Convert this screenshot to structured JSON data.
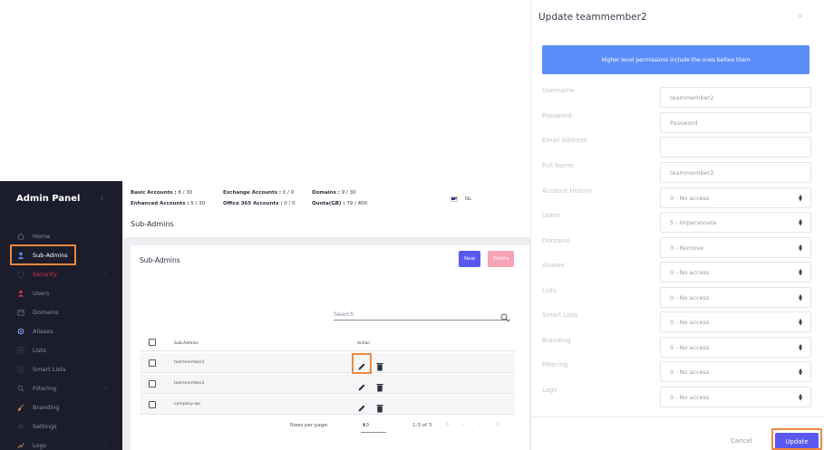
{
  "sidebar": {
    "title": "Admin Panel",
    "collapse_icon": "chevron-left-icon",
    "items": [
      {
        "label": "Home",
        "icon": "home-icon",
        "has_arrow": false
      },
      {
        "label": "Sub-Admins",
        "icon": "user-icon",
        "has_arrow": false,
        "state": "active"
      },
      {
        "label": "Security",
        "icon": "shield-icon",
        "has_arrow": true,
        "state": "red"
      },
      {
        "label": "Users",
        "icon": "users-icon",
        "has_arrow": false
      },
      {
        "label": "Domains",
        "icon": "calendar-icon",
        "has_arrow": true
      },
      {
        "label": "Aliases",
        "icon": "aliases-icon",
        "has_arrow": false
      },
      {
        "label": "Lists",
        "icon": "list-icon",
        "has_arrow": false
      },
      {
        "label": "Smart Lists",
        "icon": "smart-list-icon",
        "has_arrow": false
      },
      {
        "label": "Filtering",
        "icon": "search-icon",
        "has_arrow": true
      },
      {
        "label": "Branding",
        "icon": "brush-icon",
        "has_arrow": false
      },
      {
        "label": "Settings",
        "icon": "gear-icon",
        "has_arrow": false
      },
      {
        "label": "Logs",
        "icon": "chart-icon",
        "has_arrow": true
      }
    ]
  },
  "stats": {
    "basic_label": "Basic Accounts :",
    "basic_value": "8 / 30",
    "enhanced_label": "Enhanced Accounts :",
    "enhanced_value": "5 / 30",
    "exchange_label": "Exchange Accounts :",
    "exchange_value": "0 / 0",
    "office_label": "Office 365 Accounts :",
    "office_value": "0 / 0",
    "domains_label": "Domains :",
    "domains_value": "9 / 30",
    "quota_label": "Quota(GB) :",
    "quota_value": "79 / 400"
  },
  "language": {
    "code": "NL",
    "flag": "netherlands-flag"
  },
  "page": {
    "title": "Sub-Admins"
  },
  "card": {
    "title": "Sub-Admins",
    "new_label": "New",
    "delete_label": "Delete",
    "search_placeholder": "Search"
  },
  "table": {
    "columns": [
      "Sub-Admins",
      "Action"
    ],
    "rows": [
      {
        "name": "teammember1"
      },
      {
        "name": "teammember2"
      },
      {
        "name": "company-api"
      }
    ]
  },
  "pager": {
    "rows_per_page_label": "Rows per page:",
    "rows_per_page_value": "10",
    "range": "1-3 of 3"
  },
  "modal": {
    "title": "Update teammember2",
    "close": "×",
    "banner": "Higher level permissions include the ones before them",
    "fields": [
      {
        "label": "Username",
        "value": "teammember2",
        "type": "text"
      },
      {
        "label": "Password",
        "value": "",
        "placeholder": "Password",
        "type": "text"
      },
      {
        "label": "Email Address",
        "value": "",
        "type": "text"
      },
      {
        "label": "Full Name",
        "value": "teammember2",
        "type": "text"
      },
      {
        "label": "Account History",
        "value": "0 - No access",
        "type": "select"
      },
      {
        "label": "Users",
        "value": "5 - Impersonate",
        "type": "select"
      },
      {
        "label": "Domains",
        "value": "3 - Remove",
        "type": "select"
      },
      {
        "label": "Aliases",
        "value": "0 - No access",
        "type": "select"
      },
      {
        "label": "Lists",
        "value": "0 - No access",
        "type": "select"
      },
      {
        "label": "Smart Lists",
        "value": "0 - No access",
        "type": "select"
      },
      {
        "label": "Branding",
        "value": "0 - No access",
        "type": "select"
      },
      {
        "label": "Filtering",
        "value": "0 - No access",
        "type": "select"
      },
      {
        "label": "Logs",
        "value": "0 - No access",
        "type": "select"
      }
    ],
    "cancel_label": "Cancel",
    "update_label": "Update"
  },
  "colors": {
    "sidebar_bg": "#1c1d2c",
    "accent": "#5b58f0",
    "danger": "#e0344d",
    "banner": "#5b8dfa",
    "highlight": "#f0883e"
  }
}
